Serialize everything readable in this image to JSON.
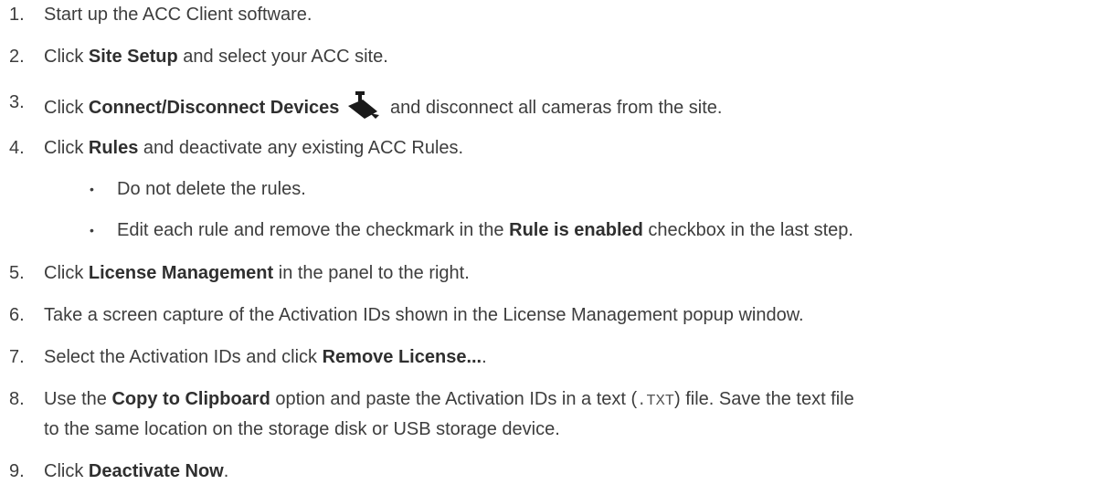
{
  "steps": [
    {
      "num": "1.",
      "pre": "Start up the ACC Client software.",
      "bold": "",
      "post": ""
    },
    {
      "num": "2.",
      "pre": "Click ",
      "bold": "Site Setup",
      "post": " and select your ACC site."
    },
    {
      "num": "3.",
      "pre": "Click ",
      "bold": "Connect/Disconnect Devices",
      "post": " and disconnect all cameras from the site.",
      "icon": "camera-disconnect-icon"
    },
    {
      "num": "4.",
      "pre": "Click ",
      "bold": "Rules",
      "post": " and deactivate any existing ACC Rules."
    },
    {
      "num": "5.",
      "pre": "Click ",
      "bold": "License Management",
      "post": " in the panel to the right."
    },
    {
      "num": "6.",
      "pre": "Take a screen capture of the Activation IDs shown in the License Management popup window.",
      "bold": "",
      "post": ""
    },
    {
      "num": "7.",
      "pre": "Select the Activation IDs and click ",
      "bold": "Remove License...",
      "post": "."
    },
    {
      "num": "8.",
      "pre": "Use the ",
      "bold": "Copy to Clipboard",
      "mid": " option and paste the Activation IDs in a text (",
      "code": ".TXT",
      "post": ") file. Save the text file",
      "cont": "to the same location on the storage disk or USB storage device."
    },
    {
      "num": "9.",
      "pre": "Click ",
      "bold": "Deactivate Now",
      "post": "."
    }
  ],
  "substeps": [
    {
      "bullet": "•",
      "pre": "Do not delete the rules.",
      "bold": "",
      "post": ""
    },
    {
      "bullet": "•",
      "pre": "Edit each rule and remove the checkmark in the ",
      "bold": "Rule is enabled",
      "post": " checkbox in the last step."
    }
  ],
  "colors": {
    "text": "#3d3d3d",
    "bold": "#2f2f2f"
  }
}
